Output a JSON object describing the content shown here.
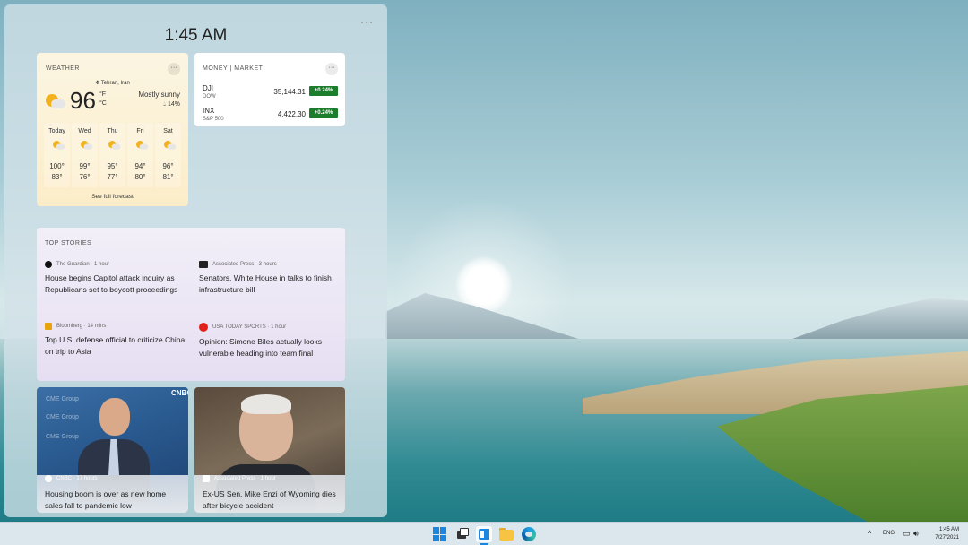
{
  "panel": {
    "time": "1:45 AM",
    "more": "···"
  },
  "weather": {
    "title": "WEATHER",
    "more": "···",
    "location": "Tehran, Iran",
    "temp": "96",
    "unit_f": "°F",
    "unit_c": "°C",
    "condition": "Mostly sunny",
    "precip": "14%",
    "forecast": [
      {
        "day": "Today",
        "hi": "100°",
        "lo": "83°"
      },
      {
        "day": "Wed",
        "hi": "99°",
        "lo": "76°"
      },
      {
        "day": "Thu",
        "hi": "95°",
        "lo": "77°"
      },
      {
        "day": "Fri",
        "hi": "94°",
        "lo": "80°"
      },
      {
        "day": "Sat",
        "hi": "96°",
        "lo": "81°"
      }
    ],
    "see_full": "See full forecast"
  },
  "money": {
    "title": "MONEY | MARKET",
    "more": "···",
    "stocks": [
      {
        "symbol": "DJI",
        "name": "DOW",
        "value": "35,144.31",
        "change": "+0.24%"
      },
      {
        "symbol": "INX",
        "name": "S&P 500",
        "value": "4,422.30",
        "change": "+0.24%"
      }
    ],
    "positive_color": "#1c7d2c"
  },
  "stories": {
    "title": "TOP STORIES",
    "items": [
      {
        "source": "The Guardian · 1 hour",
        "headline": "House begins Capitol attack inquiry as Republicans set to boycott proceedings"
      },
      {
        "source": "Associated Press · 3 hours",
        "headline": "Senators, White House in talks to finish infrastructure bill"
      },
      {
        "source": "Bloomberg · 14 mins",
        "headline": "Top U.S. defense official to criticize China on trip to Asia"
      },
      {
        "source": "USA TODAY SPORTS · 1 hour",
        "headline": "Opinion: Simone Biles actually looks vulnerable heading into team final"
      }
    ]
  },
  "news_cards": [
    {
      "source": "CNBC · 17 hours",
      "headline": "Housing boom is over as new home sales fall to pandemic low"
    },
    {
      "source": "Associated Press · 1 hour",
      "headline": "Ex-US Sen. Mike Enzi of Wyoming dies after bicycle accident"
    }
  ],
  "image_text": {
    "cme_group": "CME Group",
    "cnbc": "CNBC"
  },
  "taskbar": {
    "chevron": "^",
    "language": "ENG",
    "time": "1:45 AM",
    "date": "7/27/2021"
  },
  "icons": [
    "windows-start-icon",
    "task-view-icon",
    "widgets-icon",
    "file-explorer-icon",
    "edge-icon",
    "network-icon",
    "volume-icon",
    "sun-cloud-icon",
    "location-pin-icon",
    "droplet-icon"
  ]
}
